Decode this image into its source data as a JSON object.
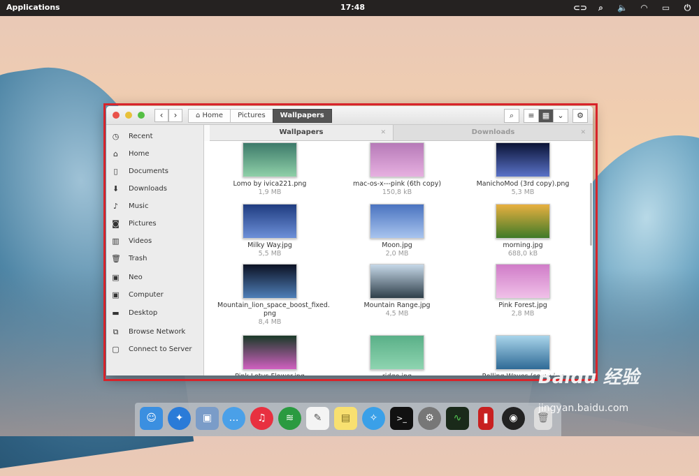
{
  "panel": {
    "applications": "Applications",
    "clock": "17:48"
  },
  "toolbar": {
    "breadcrumbs": [
      "Home",
      "Pictures",
      "Wallpapers"
    ]
  },
  "sidebar": {
    "items": [
      {
        "label": "Recent",
        "icon": "clock-icon"
      },
      {
        "label": "Home",
        "icon": "home-icon"
      },
      {
        "label": "Documents",
        "icon": "document-icon"
      },
      {
        "label": "Downloads",
        "icon": "download-icon"
      },
      {
        "label": "Music",
        "icon": "music-icon"
      },
      {
        "label": "Pictures",
        "icon": "camera-icon"
      },
      {
        "label": "Videos",
        "icon": "film-icon"
      },
      {
        "label": "Trash",
        "icon": "trash-icon"
      },
      {
        "label": "Neo",
        "icon": "drive-icon"
      },
      {
        "label": "Computer",
        "icon": "drive-icon"
      },
      {
        "label": "Desktop",
        "icon": "folder-icon"
      },
      {
        "label": "Browse Network",
        "icon": "network-icon"
      },
      {
        "label": "Connect to Server",
        "icon": "server-icon"
      }
    ]
  },
  "tabs": [
    "Wallpapers",
    "Downloads"
  ],
  "files": [
    {
      "name": "Lomo by ivica221.png",
      "size": "1,9 MB",
      "colors": [
        "#3d7a6a",
        "#8fd0a8"
      ]
    },
    {
      "name": "mac-os-x---pink (6th copy)",
      "size": "150,8 kB",
      "colors": [
        "#b67ab8",
        "#e6b0e0"
      ]
    },
    {
      "name": "ManichoMod (3rd copy).png",
      "size": "5,3 MB",
      "colors": [
        "#0b1436",
        "#5a72c8"
      ]
    },
    {
      "name": "Milky Way.jpg",
      "size": "5,5 MB",
      "colors": [
        "#1f3c80",
        "#6d90d8"
      ]
    },
    {
      "name": "Moon.jpg",
      "size": "2,0 MB",
      "colors": [
        "#4a73c0",
        "#a8c4ee"
      ]
    },
    {
      "name": "morning.jpg",
      "size": "688,0 kB",
      "colors": [
        "#e8b040",
        "#3f7a28"
      ]
    },
    {
      "name": "Mountain_lion_space_boost_fixed.png",
      "name2": "png",
      "size": "8,4 MB",
      "colors": [
        "#0c1224",
        "#4f7fb8"
      ]
    },
    {
      "name": "Mountain Range.jpg",
      "size": "4,5 MB",
      "colors": [
        "#c6d8e8",
        "#2f3f4a"
      ]
    },
    {
      "name": "Pink Forest.jpg",
      "size": "2,8 MB",
      "colors": [
        "#d07cc8",
        "#f0c0e8"
      ]
    },
    {
      "name": "Pink Lotus Flower.jpg",
      "size": "",
      "colors": [
        "#1a3a28",
        "#d060c0"
      ]
    },
    {
      "name": "ridge.jpg",
      "size": "",
      "colors": [
        "#5ab088",
        "#8ed4b0"
      ]
    },
    {
      "name": "Rolling Waves (copy).jpg",
      "size": "",
      "colors": [
        "#a8d4ea",
        "#2f6a96"
      ]
    }
  ],
  "watermark": {
    "brand": "Baidu 经验",
    "url": "jingyan.baidu.com"
  }
}
